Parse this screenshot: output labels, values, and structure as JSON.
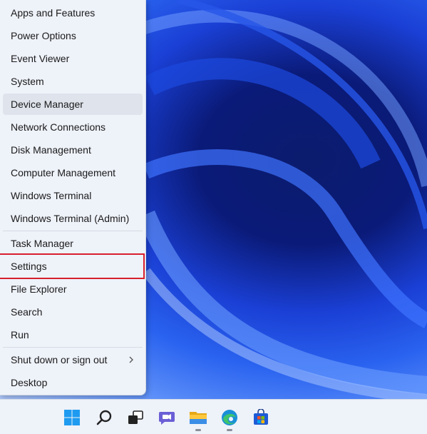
{
  "menu": {
    "items": [
      {
        "label": "Apps and Features"
      },
      {
        "label": "Power Options"
      },
      {
        "label": "Event Viewer"
      },
      {
        "label": "System"
      },
      {
        "label": "Device Manager"
      },
      {
        "label": "Network Connections"
      },
      {
        "label": "Disk Management"
      },
      {
        "label": "Computer Management"
      },
      {
        "label": "Windows Terminal"
      },
      {
        "label": "Windows Terminal (Admin)"
      },
      {
        "label": "Task Manager"
      },
      {
        "label": "Settings"
      },
      {
        "label": "File Explorer"
      },
      {
        "label": "Search"
      },
      {
        "label": "Run"
      },
      {
        "label": "Shut down or sign out",
        "submenu_icon": "chevron-right-icon"
      },
      {
        "label": "Desktop"
      }
    ],
    "hovered_item": "Device Manager",
    "highlighted_item": "Settings",
    "highlight_color": "#d61f2c"
  },
  "taskbar": {
    "icons": [
      {
        "name": "windows-start-icon"
      },
      {
        "name": "search-icon"
      },
      {
        "name": "task-view-icon"
      },
      {
        "name": "teams-chat-icon"
      },
      {
        "name": "file-explorer-icon",
        "running": true
      },
      {
        "name": "edge-browser-icon",
        "running": true
      },
      {
        "name": "microsoft-store-icon"
      }
    ]
  }
}
